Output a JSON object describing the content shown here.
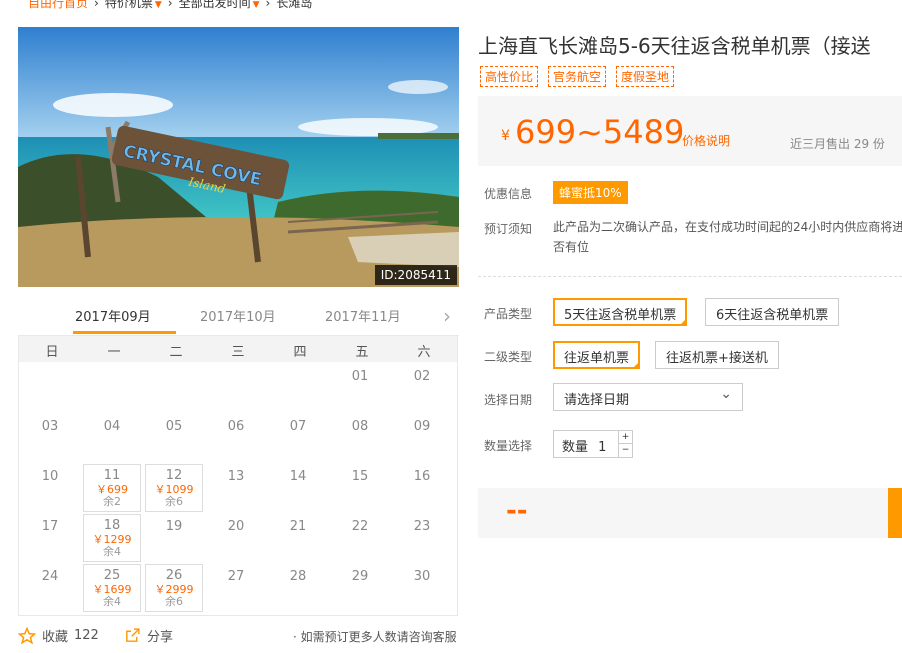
{
  "breadcrumb": {
    "home": "自由行首页",
    "cat1": "特价机票",
    "cat2": "全部出发时间",
    "current": "长滩岛"
  },
  "hero": {
    "id_badge": "ID:2085411",
    "sign_text": "CRYSTAL COVE",
    "sign_sub": "Island"
  },
  "months": [
    "2017年09月",
    "2017年10月",
    "2017年11月"
  ],
  "weekdays": [
    "日",
    "一",
    "二",
    "三",
    "四",
    "五",
    "六"
  ],
  "calendar": {
    "days": [
      "01",
      "02",
      "03",
      "04",
      "05",
      "06",
      "07",
      "08",
      "09",
      "10",
      "11",
      "12",
      "13",
      "14",
      "15",
      "16",
      "17",
      "18",
      "19",
      "20",
      "21",
      "22",
      "23",
      "24",
      "25",
      "26",
      "27",
      "28",
      "29",
      "30"
    ],
    "avail": {
      "11": {
        "price": "￥699",
        "stock": "余2"
      },
      "12": {
        "price": "￥1099",
        "stock": "余6"
      },
      "18": {
        "price": "￥1299",
        "stock": "余4"
      },
      "25": {
        "price": "￥1699",
        "stock": "余4"
      },
      "26": {
        "price": "￥2999",
        "stock": "余6"
      }
    }
  },
  "footer": {
    "favorite_label": "收藏",
    "favorite_count": "122",
    "share_label": "分享",
    "note": "· 如需预订更多人数请咨询客服"
  },
  "product": {
    "title": "上海直飞长滩岛5-6天往返含税单机票（接送",
    "tags": [
      "高性价比",
      "官务航空",
      "度假圣地"
    ],
    "price_symbol": "¥",
    "price_range": "699~5489",
    "price_explain": "价格说明",
    "sold": "近三月售出 29 份"
  },
  "info": {
    "promo_label": "优惠信息",
    "promo_badge": "蜂蜜抵10%",
    "notice_label": "预订须知",
    "notice_line1": "此产品为二次确认产品，在支付成功时间起的24小时内供应商将进",
    "notice_line2": "否有位"
  },
  "options": {
    "type_label": "产品类型",
    "types": [
      "5天往返含税单机票",
      "6天往返含税单机票"
    ],
    "subtype_label": "二级类型",
    "subtypes": [
      "往返单机票",
      "往返机票+接送机"
    ],
    "date_label": "选择日期",
    "date_placeholder": "请选择日期",
    "qty_label": "数量选择",
    "qty_prefix": "数量",
    "qty_value": "1"
  },
  "book": {
    "price_placeholder": "--"
  }
}
